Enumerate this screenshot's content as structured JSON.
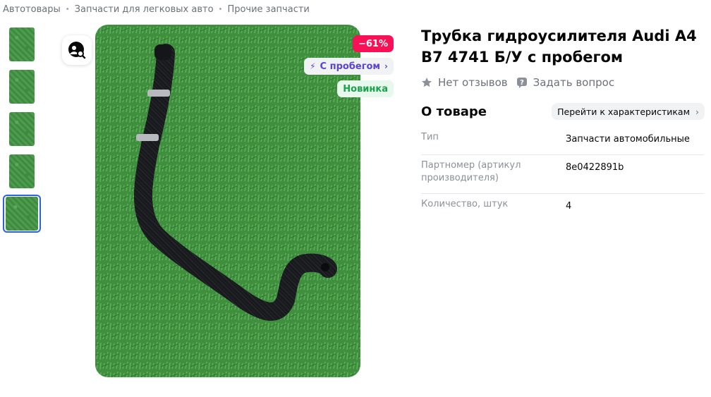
{
  "breadcrumb": {
    "items": [
      "Автотовары",
      "Запчасти для легковых авто",
      "Прочие запчасти"
    ]
  },
  "gallery": {
    "thumbnail_count": 5,
    "active_thumbnail": 5
  },
  "badges": {
    "discount": "−61%",
    "used": "С пробегом",
    "new": "Новинка"
  },
  "product": {
    "title": "Трубка гидроусилителя Audi A4 B7 4741 Б/У с пробегом",
    "reviews": "Нет отзывов",
    "ask_question": "Задать вопрос"
  },
  "about": {
    "heading": "О товаре",
    "chars_link": "Перейти к характеристикам"
  },
  "specs": [
    {
      "key": "Тип",
      "value": "Запчасти автомобильные"
    },
    {
      "key": "Партномер (артикул производителя)",
      "value": "8e0422891b"
    },
    {
      "key": "Количество, штук",
      "value": "4"
    }
  ],
  "colors": {
    "accent": "#2a63e0",
    "discount": "#f91155",
    "used_badge_text": "#5a43d6",
    "new_badge_text": "#17a34a"
  },
  "icons": [
    "camera-search-icon",
    "bolt-icon",
    "chevron-right-icon",
    "star-icon",
    "question-icon"
  ]
}
